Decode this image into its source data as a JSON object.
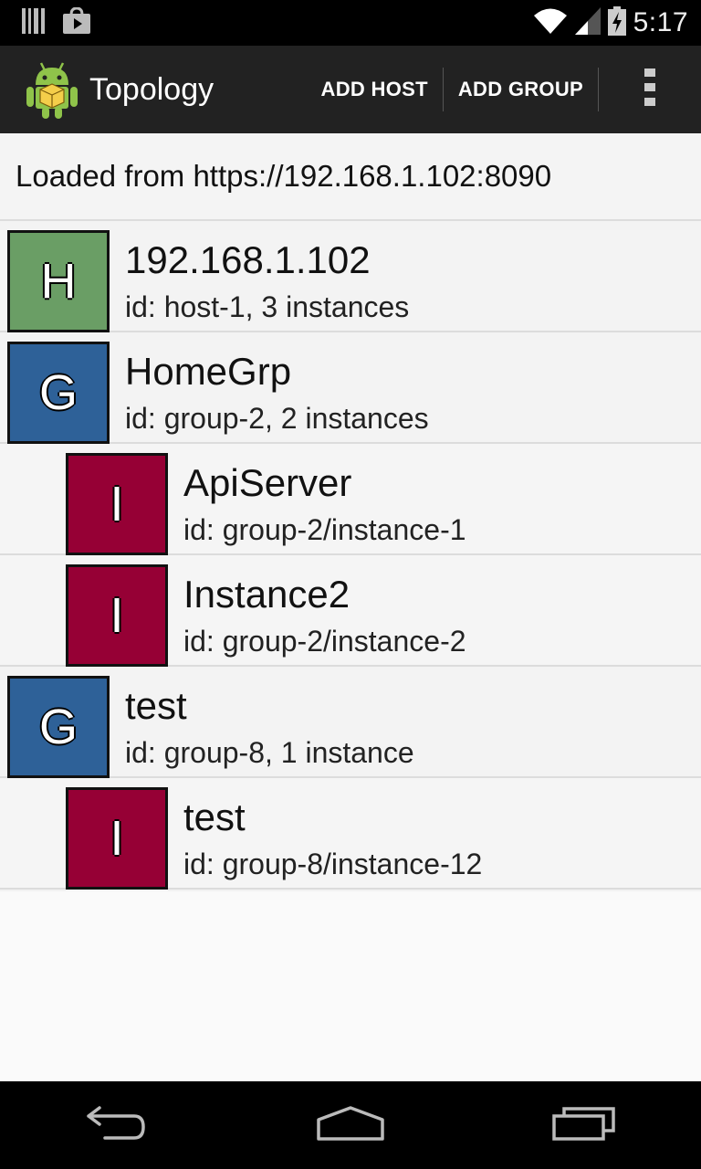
{
  "status_bar": {
    "time": "5:17",
    "icons": [
      "barcode-icon",
      "store-icon",
      "wifi-icon",
      "cell-signal-icon",
      "battery-charging-icon"
    ]
  },
  "action_bar": {
    "title": "Topology",
    "add_host_label": "ADD HOST",
    "add_group_label": "ADD GROUP",
    "icons": [
      "android-logo-icon",
      "overflow-menu-icon"
    ]
  },
  "header": {
    "loaded_text": "Loaded from https://192.168.1.102:8090"
  },
  "colors": {
    "host": "#6a9e65",
    "group": "#2e6198",
    "instance": "#960035"
  },
  "items": [
    {
      "kind": "host",
      "badge": "H",
      "name": "192.168.1.102",
      "sub": "id: host-1, 3 instances"
    },
    {
      "kind": "group",
      "badge": "G",
      "name": "HomeGrp",
      "sub": "id: group-2, 2 instances"
    },
    {
      "kind": "instance",
      "badge": "I",
      "name": "ApiServer",
      "sub": "id: group-2/instance-1"
    },
    {
      "kind": "instance",
      "badge": "I",
      "name": "Instance2",
      "sub": "id: group-2/instance-2"
    },
    {
      "kind": "group",
      "badge": "G",
      "name": "test",
      "sub": "id: group-8, 1 instance"
    },
    {
      "kind": "instance",
      "badge": "I",
      "name": "test",
      "sub": "id: group-8/instance-12"
    }
  ],
  "nav_bar": {
    "icons": [
      "back-icon",
      "home-icon",
      "recents-icon"
    ]
  }
}
